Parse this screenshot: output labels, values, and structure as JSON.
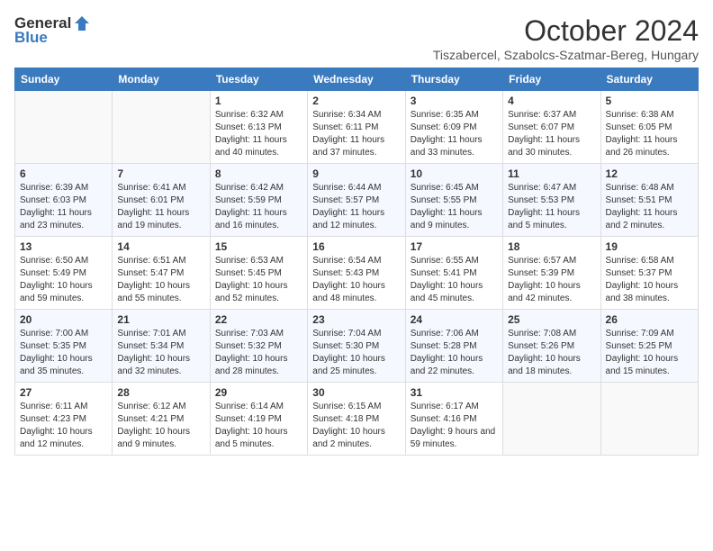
{
  "logo": {
    "general": "General",
    "blue": "Blue"
  },
  "title": "October 2024",
  "location": "Tiszabercel, Szabolcs-Szatmar-Bereg, Hungary",
  "weekdays": [
    "Sunday",
    "Monday",
    "Tuesday",
    "Wednesday",
    "Thursday",
    "Friday",
    "Saturday"
  ],
  "weeks": [
    [
      {
        "day": "",
        "sunrise": "",
        "sunset": "",
        "daylight": ""
      },
      {
        "day": "",
        "sunrise": "",
        "sunset": "",
        "daylight": ""
      },
      {
        "day": "1",
        "sunrise": "Sunrise: 6:32 AM",
        "sunset": "Sunset: 6:13 PM",
        "daylight": "Daylight: 11 hours and 40 minutes."
      },
      {
        "day": "2",
        "sunrise": "Sunrise: 6:34 AM",
        "sunset": "Sunset: 6:11 PM",
        "daylight": "Daylight: 11 hours and 37 minutes."
      },
      {
        "day": "3",
        "sunrise": "Sunrise: 6:35 AM",
        "sunset": "Sunset: 6:09 PM",
        "daylight": "Daylight: 11 hours and 33 minutes."
      },
      {
        "day": "4",
        "sunrise": "Sunrise: 6:37 AM",
        "sunset": "Sunset: 6:07 PM",
        "daylight": "Daylight: 11 hours and 30 minutes."
      },
      {
        "day": "5",
        "sunrise": "Sunrise: 6:38 AM",
        "sunset": "Sunset: 6:05 PM",
        "daylight": "Daylight: 11 hours and 26 minutes."
      }
    ],
    [
      {
        "day": "6",
        "sunrise": "Sunrise: 6:39 AM",
        "sunset": "Sunset: 6:03 PM",
        "daylight": "Daylight: 11 hours and 23 minutes."
      },
      {
        "day": "7",
        "sunrise": "Sunrise: 6:41 AM",
        "sunset": "Sunset: 6:01 PM",
        "daylight": "Daylight: 11 hours and 19 minutes."
      },
      {
        "day": "8",
        "sunrise": "Sunrise: 6:42 AM",
        "sunset": "Sunset: 5:59 PM",
        "daylight": "Daylight: 11 hours and 16 minutes."
      },
      {
        "day": "9",
        "sunrise": "Sunrise: 6:44 AM",
        "sunset": "Sunset: 5:57 PM",
        "daylight": "Daylight: 11 hours and 12 minutes."
      },
      {
        "day": "10",
        "sunrise": "Sunrise: 6:45 AM",
        "sunset": "Sunset: 5:55 PM",
        "daylight": "Daylight: 11 hours and 9 minutes."
      },
      {
        "day": "11",
        "sunrise": "Sunrise: 6:47 AM",
        "sunset": "Sunset: 5:53 PM",
        "daylight": "Daylight: 11 hours and 5 minutes."
      },
      {
        "day": "12",
        "sunrise": "Sunrise: 6:48 AM",
        "sunset": "Sunset: 5:51 PM",
        "daylight": "Daylight: 11 hours and 2 minutes."
      }
    ],
    [
      {
        "day": "13",
        "sunrise": "Sunrise: 6:50 AM",
        "sunset": "Sunset: 5:49 PM",
        "daylight": "Daylight: 10 hours and 59 minutes."
      },
      {
        "day": "14",
        "sunrise": "Sunrise: 6:51 AM",
        "sunset": "Sunset: 5:47 PM",
        "daylight": "Daylight: 10 hours and 55 minutes."
      },
      {
        "day": "15",
        "sunrise": "Sunrise: 6:53 AM",
        "sunset": "Sunset: 5:45 PM",
        "daylight": "Daylight: 10 hours and 52 minutes."
      },
      {
        "day": "16",
        "sunrise": "Sunrise: 6:54 AM",
        "sunset": "Sunset: 5:43 PM",
        "daylight": "Daylight: 10 hours and 48 minutes."
      },
      {
        "day": "17",
        "sunrise": "Sunrise: 6:55 AM",
        "sunset": "Sunset: 5:41 PM",
        "daylight": "Daylight: 10 hours and 45 minutes."
      },
      {
        "day": "18",
        "sunrise": "Sunrise: 6:57 AM",
        "sunset": "Sunset: 5:39 PM",
        "daylight": "Daylight: 10 hours and 42 minutes."
      },
      {
        "day": "19",
        "sunrise": "Sunrise: 6:58 AM",
        "sunset": "Sunset: 5:37 PM",
        "daylight": "Daylight: 10 hours and 38 minutes."
      }
    ],
    [
      {
        "day": "20",
        "sunrise": "Sunrise: 7:00 AM",
        "sunset": "Sunset: 5:35 PM",
        "daylight": "Daylight: 10 hours and 35 minutes."
      },
      {
        "day": "21",
        "sunrise": "Sunrise: 7:01 AM",
        "sunset": "Sunset: 5:34 PM",
        "daylight": "Daylight: 10 hours and 32 minutes."
      },
      {
        "day": "22",
        "sunrise": "Sunrise: 7:03 AM",
        "sunset": "Sunset: 5:32 PM",
        "daylight": "Daylight: 10 hours and 28 minutes."
      },
      {
        "day": "23",
        "sunrise": "Sunrise: 7:04 AM",
        "sunset": "Sunset: 5:30 PM",
        "daylight": "Daylight: 10 hours and 25 minutes."
      },
      {
        "day": "24",
        "sunrise": "Sunrise: 7:06 AM",
        "sunset": "Sunset: 5:28 PM",
        "daylight": "Daylight: 10 hours and 22 minutes."
      },
      {
        "day": "25",
        "sunrise": "Sunrise: 7:08 AM",
        "sunset": "Sunset: 5:26 PM",
        "daylight": "Daylight: 10 hours and 18 minutes."
      },
      {
        "day": "26",
        "sunrise": "Sunrise: 7:09 AM",
        "sunset": "Sunset: 5:25 PM",
        "daylight": "Daylight: 10 hours and 15 minutes."
      }
    ],
    [
      {
        "day": "27",
        "sunrise": "Sunrise: 6:11 AM",
        "sunset": "Sunset: 4:23 PM",
        "daylight": "Daylight: 10 hours and 12 minutes."
      },
      {
        "day": "28",
        "sunrise": "Sunrise: 6:12 AM",
        "sunset": "Sunset: 4:21 PM",
        "daylight": "Daylight: 10 hours and 9 minutes."
      },
      {
        "day": "29",
        "sunrise": "Sunrise: 6:14 AM",
        "sunset": "Sunset: 4:19 PM",
        "daylight": "Daylight: 10 hours and 5 minutes."
      },
      {
        "day": "30",
        "sunrise": "Sunrise: 6:15 AM",
        "sunset": "Sunset: 4:18 PM",
        "daylight": "Daylight: 10 hours and 2 minutes."
      },
      {
        "day": "31",
        "sunrise": "Sunrise: 6:17 AM",
        "sunset": "Sunset: 4:16 PM",
        "daylight": "Daylight: 9 hours and 59 minutes."
      },
      {
        "day": "",
        "sunrise": "",
        "sunset": "",
        "daylight": ""
      },
      {
        "day": "",
        "sunrise": "",
        "sunset": "",
        "daylight": ""
      }
    ]
  ]
}
